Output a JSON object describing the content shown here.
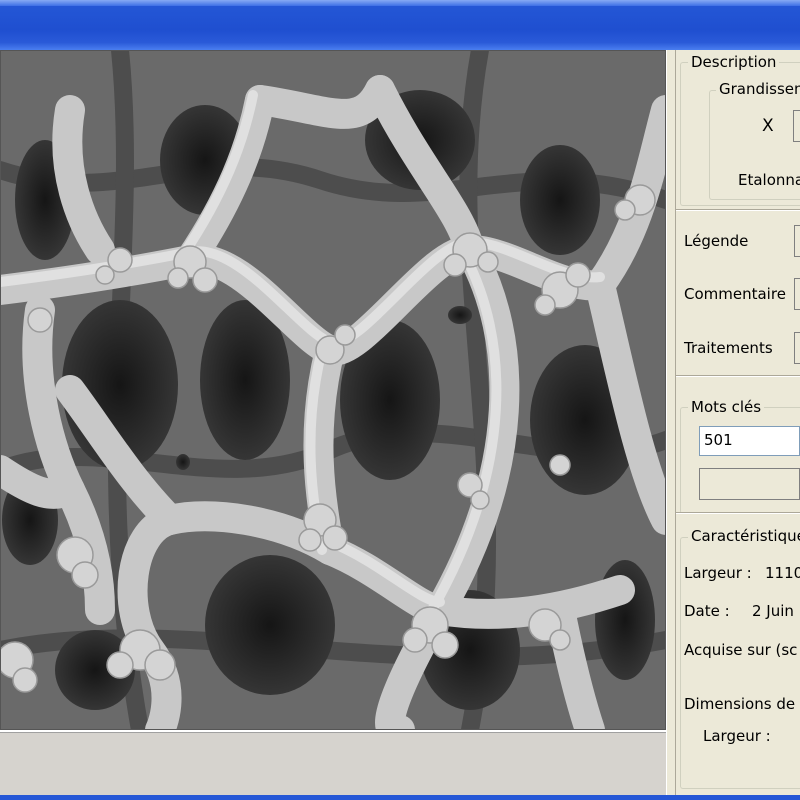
{
  "panel": {
    "description": {
      "title": "Description",
      "grandissement_title": "Grandissem",
      "multiplier": "X",
      "etalonnage": "Etalonna"
    },
    "legende_label": "Légende",
    "commentaire_label": "Commentaire",
    "traitements_label": "Traitements",
    "mots_cles": {
      "title": "Mots clés",
      "value": "501",
      "second_value": ""
    },
    "caracteristiques": {
      "title": "Caractéristique",
      "largeur_label": "Largeur :",
      "largeur_value": "1110",
      "date_label": "Date :",
      "date_value": "2 Juin",
      "acquise_label": "Acquise sur (sc",
      "dimensions_label": "Dimensions de",
      "dim_largeur_label": "Largeur :"
    }
  },
  "image": {
    "content": "grayscale electron microscope image of a porous reticulated network"
  },
  "colors": {
    "titlebar": "#1f4fd0",
    "panel_bg": "#ece9d8",
    "textbox_border": "#7f9db9"
  }
}
